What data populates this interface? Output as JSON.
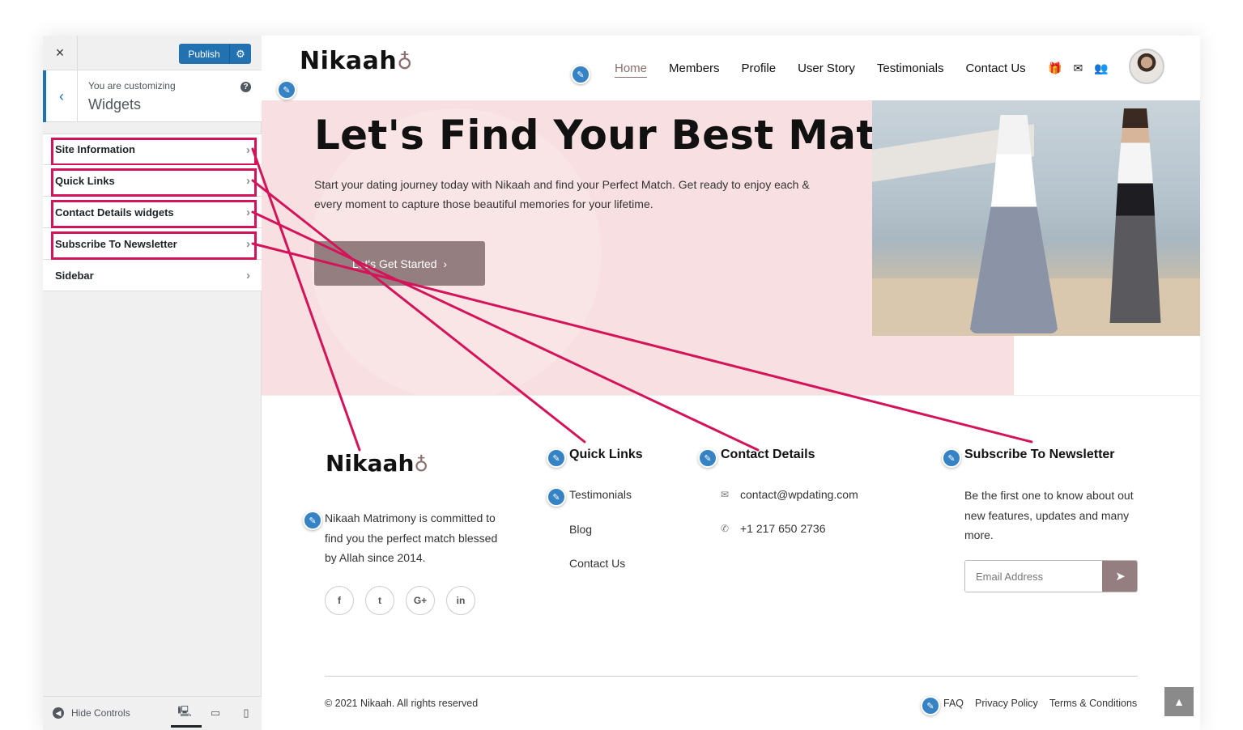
{
  "customizer": {
    "close_icon": "×",
    "publish_label": "Publish",
    "customizing_label": "You are customizing",
    "section_title": "Widgets",
    "items": [
      {
        "label": "Site Information"
      },
      {
        "label": "Quick Links"
      },
      {
        "label": "Contact Details widgets"
      },
      {
        "label": "Subscribe To Newsletter"
      },
      {
        "label": "Sidebar"
      }
    ],
    "hide_controls_label": "Hide Controls",
    "accent_color": "#2271b1",
    "highlight_color": "#d3145a"
  },
  "site": {
    "logo": "Nikaah",
    "logo_rings": "♁",
    "nav": [
      "Home",
      "Members",
      "Profile",
      "User Story",
      "Testimonials",
      "Contact Us"
    ],
    "nav_icons": [
      "gift-icon",
      "envelope-icon",
      "users-icon"
    ],
    "hero": {
      "title": "Let's Find Your Best Match",
      "text": "Start your dating journey today with Nikaah and find your Perfect Match. Get ready to enjoy each & every moment to capture those beautiful memories for your lifetime.",
      "button": "Let's Get Started",
      "background": "#f8dfe1"
    },
    "footer": {
      "about": "Nikaah Matrimony is committed to find you the perfect match blessed by Allah since 2014.",
      "socials": [
        "f",
        "t",
        "G+",
        "in"
      ],
      "quick_links_title": "Quick Links",
      "quick_links": [
        "Testimonials",
        "Blog",
        "Contact Us"
      ],
      "contact_title": "Contact Details",
      "email": "contact@wpdating.com",
      "phone": "+1 217 650 2736",
      "newsletter_title": "Subscribe To Newsletter",
      "newsletter_text": "Be the first one to know about out new features, updates and many more.",
      "email_placeholder": "Email Address",
      "copyright": "© 2021 Nikaah. All rights reserved",
      "legal": [
        "FAQ",
        "Privacy Policy",
        "Terms & Conditions"
      ]
    },
    "brand_color": "#957e80"
  }
}
